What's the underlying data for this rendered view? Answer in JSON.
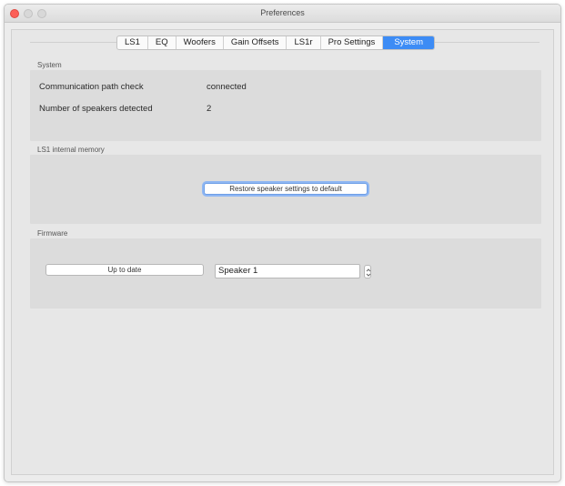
{
  "window": {
    "title": "Preferences"
  },
  "tabs": [
    {
      "label": "LS1"
    },
    {
      "label": "EQ"
    },
    {
      "label": "Woofers"
    },
    {
      "label": "Gain Offsets"
    },
    {
      "label": "LS1r"
    },
    {
      "label": "Pro Settings"
    },
    {
      "label": "System",
      "active": true
    }
  ],
  "system": {
    "heading": "System",
    "comm_label": "Communication path check",
    "comm_value": "connected",
    "speakers_label": "Number of speakers detected",
    "speakers_value": "2"
  },
  "memory": {
    "heading": "LS1 internal memory",
    "restore_label": "Restore speaker settings to default"
  },
  "firmware": {
    "heading": "Firmware",
    "status_label": "Up to date",
    "speaker_value": "Speaker 1"
  },
  "colors": {
    "accent": "#3d8cf5",
    "close": "#fc5f57"
  }
}
